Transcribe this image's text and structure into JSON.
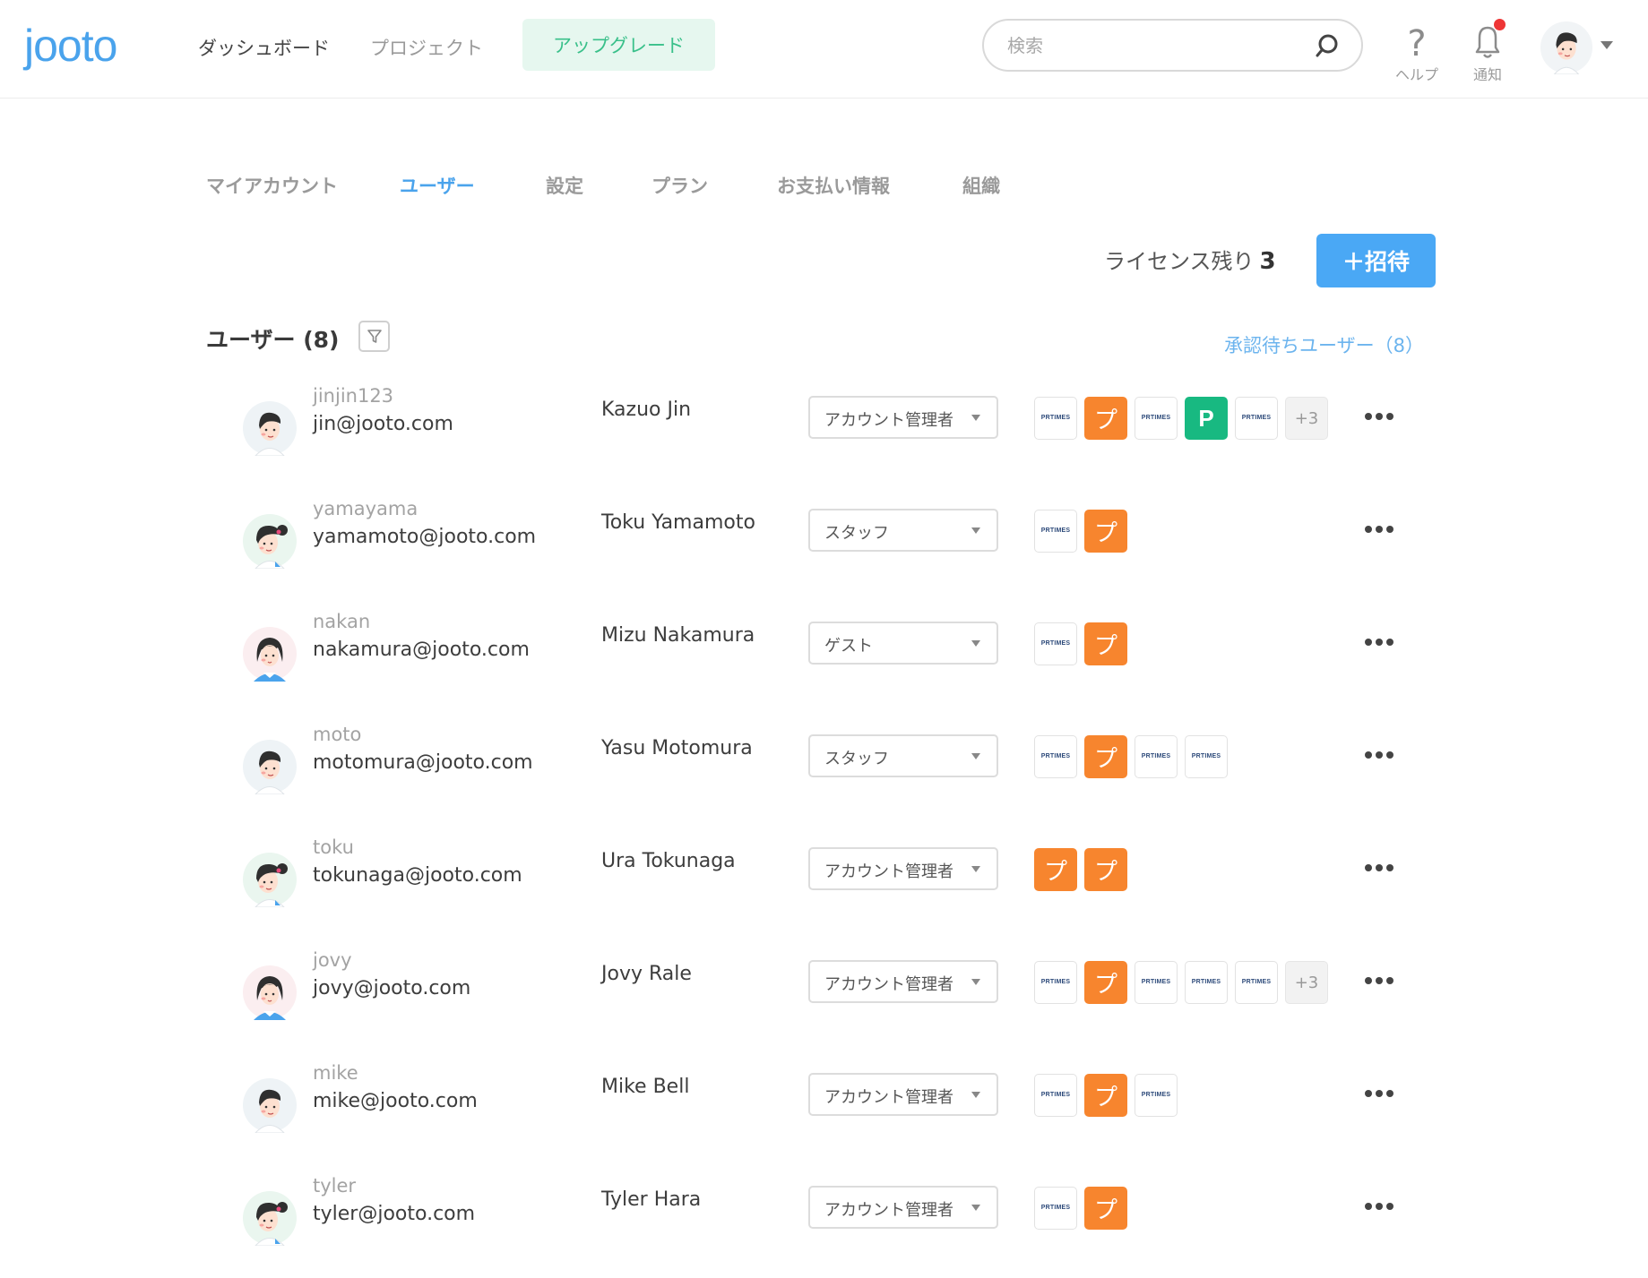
{
  "header": {
    "logo": "jooto",
    "nav": [
      "ダッシュボード",
      "プロジェクト"
    ],
    "upgrade_label": "アップグレード",
    "search_placeholder": "検索",
    "help_label": "ヘルプ",
    "notif_label": "通知"
  },
  "tabs": [
    {
      "label": "マイアカウント",
      "active": false
    },
    {
      "label": "ユーザー",
      "active": true
    },
    {
      "label": "設定",
      "active": false
    },
    {
      "label": "プラン",
      "active": false
    },
    {
      "label": "お支払い情報",
      "active": false
    },
    {
      "label": "組織",
      "active": false
    }
  ],
  "license": {
    "label": "ライセンス残り",
    "count": "3"
  },
  "invite_label": "＋招待",
  "users_section": {
    "title": "ユーザー (8)",
    "pending_link": "承認待ちユーザー（8）"
  },
  "project_badges": {
    "prtimes": "PRTIMES",
    "pu": "プ",
    "p": "P"
  },
  "colors": {
    "brand_blue": "#4aa3ec",
    "invite_blue": "#4aa8f5",
    "upgrade_green": "#39c08a",
    "orange": "#f7852e",
    "green": "#18b981",
    "notif_red": "#ee3535"
  },
  "users": [
    {
      "username": "jinjin123",
      "email": "jin@jooto.com",
      "name": "Kazuo Jin",
      "role": "アカウント管理者",
      "avatar": "man",
      "projects": [
        "pr",
        "pu",
        "pr",
        "pg",
        "pr"
      ],
      "more": "+3"
    },
    {
      "username": "yamayama",
      "email": "yamamoto@jooto.com",
      "name": "Toku Yamamoto",
      "role": "スタッフ",
      "avatar": "girl",
      "projects": [
        "pr",
        "pu"
      ],
      "more": ""
    },
    {
      "username": "nakan",
      "email": "nakamura@jooto.com",
      "name": "Mizu Nakamura",
      "role": "ゲスト",
      "avatar": "woman",
      "projects": [
        "pr",
        "pu"
      ],
      "more": ""
    },
    {
      "username": "moto",
      "email": "motomura@jooto.com",
      "name": "Yasu Motomura",
      "role": "スタッフ",
      "avatar": "man",
      "projects": [
        "pr",
        "pu",
        "pr",
        "pr"
      ],
      "more": ""
    },
    {
      "username": "toku",
      "email": "tokunaga@jooto.com",
      "name": "Ura Tokunaga",
      "role": "アカウント管理者",
      "avatar": "girl",
      "projects": [
        "pu",
        "pu"
      ],
      "more": ""
    },
    {
      "username": "jovy",
      "email": "jovy@jooto.com",
      "name": "Jovy Rale",
      "role": "アカウント管理者",
      "avatar": "woman",
      "projects": [
        "pr",
        "pu",
        "pr",
        "pr",
        "pr"
      ],
      "more": "+3"
    },
    {
      "username": "mike",
      "email": "mike@jooto.com",
      "name": "Mike Bell",
      "role": "アカウント管理者",
      "avatar": "man",
      "projects": [
        "pr",
        "pu",
        "pr"
      ],
      "more": ""
    },
    {
      "username": "tyler",
      "email": "tyler@jooto.com",
      "name": "Tyler Hara",
      "role": "アカウント管理者",
      "avatar": "girl",
      "projects": [
        "pr",
        "pu"
      ],
      "more": ""
    }
  ]
}
